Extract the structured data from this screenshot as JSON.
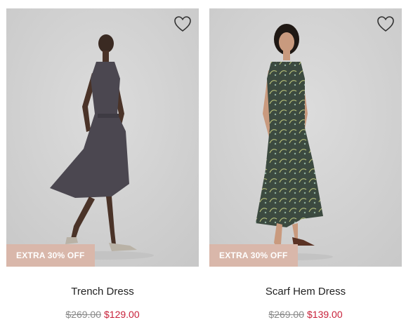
{
  "products": [
    {
      "name": "Trench Dress",
      "badge": "EXTRA 30% OFF",
      "original_price": "$269.00",
      "sale_price": "$129.00",
      "wishlist_icon": "heart-outline-icon",
      "dress_color": "#4b4750"
    },
    {
      "name": "Scarf Hem Dress",
      "badge": "EXTRA 30% OFF",
      "original_price": "$269.00",
      "sale_price": "$139.00",
      "wishlist_icon": "heart-outline-icon",
      "dress_color": "#3c4a40"
    }
  ],
  "colors": {
    "badge_bg": "#d9b7aa",
    "sale_price": "#c8213a",
    "original_price": "#8a8a8a",
    "image_bg": "#d2d2d2"
  }
}
